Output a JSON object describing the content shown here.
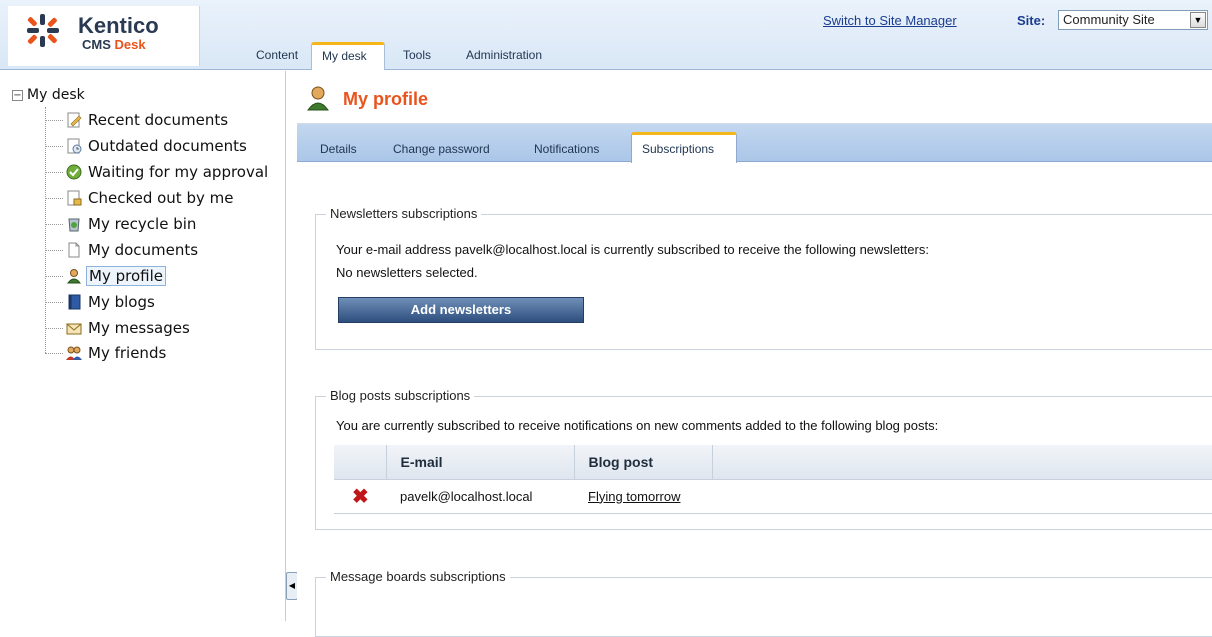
{
  "header": {
    "logo_name": "Kentico",
    "logo_cms": "CMS",
    "logo_desk": "Desk",
    "switch_link": "Switch to Site Manager",
    "site_label": "Site:",
    "site_value": "Community Site",
    "nav": [
      "Content",
      "My desk",
      "Tools",
      "Administration"
    ],
    "active_nav": "My desk"
  },
  "tree": {
    "root": "My desk",
    "items": [
      {
        "label": "Recent documents",
        "icon": "recent-documents-icon"
      },
      {
        "label": "Outdated documents",
        "icon": "outdated-documents-icon"
      },
      {
        "label": "Waiting for my approval",
        "icon": "approval-icon"
      },
      {
        "label": "Checked out by me",
        "icon": "checked-out-icon"
      },
      {
        "label": "My recycle bin",
        "icon": "recycle-bin-icon"
      },
      {
        "label": "My documents",
        "icon": "documents-icon"
      },
      {
        "label": "My profile",
        "icon": "profile-icon"
      },
      {
        "label": "My blogs",
        "icon": "blogs-icon"
      },
      {
        "label": "My messages",
        "icon": "messages-icon"
      },
      {
        "label": "My friends",
        "icon": "friends-icon"
      }
    ],
    "selected": "My profile"
  },
  "page": {
    "title": "My profile",
    "tabs": [
      "Details",
      "Change password",
      "Notifications",
      "Subscriptions"
    ],
    "active_tab": "Subscriptions"
  },
  "newsletters": {
    "legend": "Newsletters subscriptions",
    "text": "Your e-mail address pavelk@localhost.local is currently subscribed to receive the following newsletters:",
    "empty": "No newsletters selected.",
    "button": "Add newsletters"
  },
  "blogposts": {
    "legend": "Blog posts subscriptions",
    "text": "You are currently subscribed to receive notifications on new comments added to the following blog posts:",
    "columns": [
      "E-mail",
      "Blog post"
    ],
    "rows": [
      {
        "email": "pavelk@localhost.local",
        "post": "Flying tomorrow"
      }
    ]
  },
  "messageboards": {
    "legend": "Message boards subscriptions"
  },
  "colors": {
    "accent": "#e8541c",
    "tab_highlight": "#f5b619",
    "link": "#1a3d8f",
    "button": "#2e4f7e"
  }
}
